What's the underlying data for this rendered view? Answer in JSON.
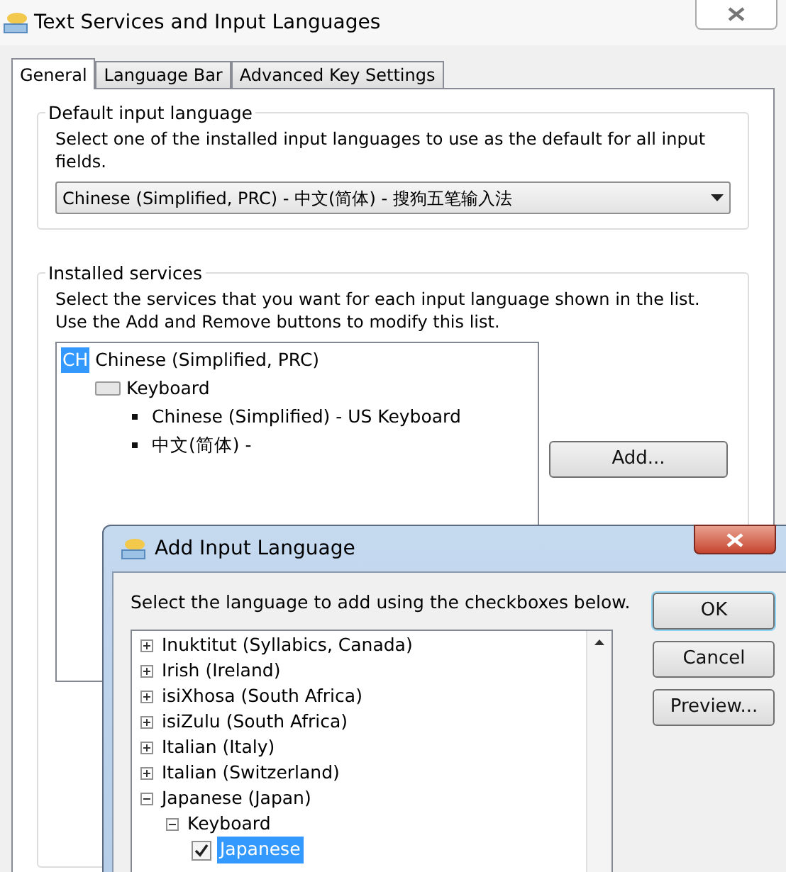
{
  "window": {
    "title": "Text Services and Input Languages"
  },
  "tabs": [
    {
      "label": "General",
      "selected": true
    },
    {
      "label": "Language Bar",
      "selected": false
    },
    {
      "label": "Advanced Key Settings",
      "selected": false
    }
  ],
  "default_input_language": {
    "title": "Default input language",
    "description": "Select one of the installed input languages to use as the default for all input fields.",
    "value": "Chinese (Simplified, PRC) - 中文(简体) - 搜狗五笔输入法"
  },
  "installed_services": {
    "title": "Installed services",
    "description": "Select the services that you want for each input language shown in the list. Use the Add and Remove buttons to modify this list.",
    "tree": [
      {
        "badge": "CH",
        "label": "Chinese (Simplified, PRC)",
        "selected": true,
        "children": [
          {
            "label": "Keyboard",
            "children": [
              {
                "label": "Chinese (Simplified) - US Keyboard"
              },
              {
                "label": "中文(简体) -"
              }
            ]
          }
        ]
      }
    ],
    "buttons": [
      "Add..."
    ]
  },
  "dialog": {
    "title": "Add Input Language",
    "instruction": "Select the language to add using the checkboxes below.",
    "items": [
      {
        "kind": "language",
        "label": "Inuktitut (Syllabics, Canada)",
        "expanded": false
      },
      {
        "kind": "language",
        "label": "Irish (Ireland)",
        "expanded": false
      },
      {
        "kind": "language",
        "label": "isiXhosa (South Africa)",
        "expanded": false
      },
      {
        "kind": "language",
        "label": "isiZulu (South Africa)",
        "expanded": false
      },
      {
        "kind": "language",
        "label": "Italian (Italy)",
        "expanded": false
      },
      {
        "kind": "language",
        "label": "Italian (Switzerland)",
        "expanded": false
      },
      {
        "kind": "language",
        "label": "Japanese (Japan)",
        "expanded": true,
        "children": [
          {
            "kind": "group",
            "label": "Keyboard",
            "expanded": true,
            "children": [
              {
                "kind": "checkbox",
                "label": "Japanese",
                "checked": true,
                "selected": true
              }
            ]
          }
        ]
      }
    ],
    "buttons": [
      "OK",
      "Cancel",
      "Preview..."
    ]
  }
}
